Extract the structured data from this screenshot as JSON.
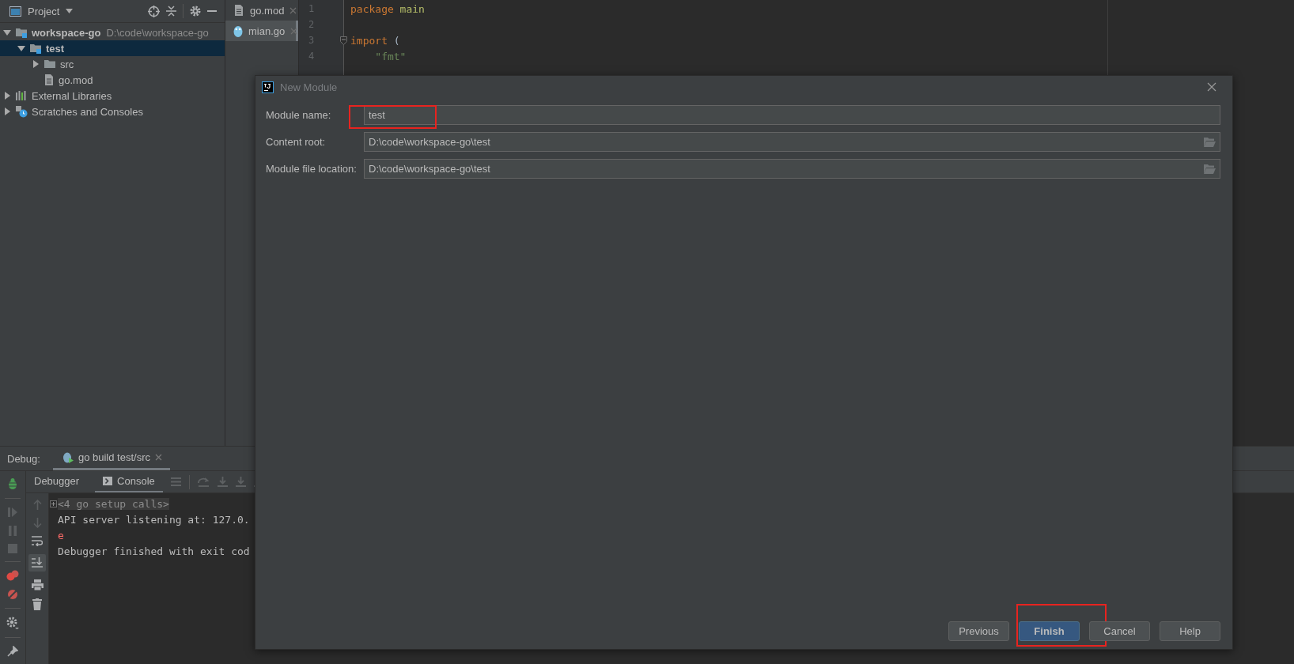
{
  "project_panel": {
    "title": "Project",
    "tree": [
      {
        "label": "workspace-go",
        "path": "D:\\code\\workspace-go",
        "kind": "module",
        "expanded": true,
        "selected": false,
        "children": [
          {
            "label": "test",
            "kind": "module",
            "expanded": true,
            "selected": true,
            "children": [
              {
                "label": "src",
                "kind": "folder",
                "expanded": false,
                "selected": false
              },
              {
                "label": "go.mod",
                "kind": "file",
                "selected": false
              }
            ]
          }
        ]
      },
      {
        "label": "External Libraries",
        "kind": "libraries",
        "expanded": false,
        "selected": false
      },
      {
        "label": "Scratches and Consoles",
        "kind": "scratches",
        "expanded": false,
        "selected": false
      }
    ]
  },
  "editor": {
    "tabs": [
      {
        "label": "go.mod",
        "kind": "mod",
        "selected": false
      },
      {
        "label": "mian.go",
        "kind": "go",
        "selected": true
      }
    ],
    "lines": [
      {
        "number": "1",
        "fold": false,
        "tokens": [
          {
            "text": "package",
            "kind": "keyword"
          },
          {
            "text": " main",
            "kind": "package_name"
          }
        ]
      },
      {
        "number": "2",
        "fold": false
      },
      {
        "number": "3",
        "fold": true,
        "tokens": [
          {
            "text": "import",
            "kind": "keyword"
          },
          {
            "text": " (",
            "kind": "plain"
          }
        ]
      },
      {
        "number": "4",
        "fold": false,
        "tokens": [
          {
            "text": "    \"fmt\"",
            "kind": "string"
          }
        ]
      }
    ]
  },
  "debug": {
    "label": "Debug:",
    "session_tab": {
      "label": "go build test/src",
      "selected": true
    },
    "tabs": [
      {
        "label": "Debugger",
        "kind": "debugger",
        "selected": false
      },
      {
        "label": "Console",
        "kind": "console",
        "selected": true
      }
    ],
    "scroll_to_end": true,
    "console": [
      {
        "text": "<4 go setup calls>",
        "kind": "folded"
      },
      {
        "text": "API server listening at: 127.0.",
        "kind": "output"
      },
      {
        "text": "e",
        "kind": "error"
      },
      {
        "text": "Debugger finished with exit cod",
        "kind": "output"
      }
    ]
  },
  "dialog": {
    "title": "New Module",
    "fields": [
      {
        "label": "Module name:",
        "value": "test",
        "browse": false,
        "highlighted": true
      },
      {
        "label": "Content root:",
        "value": "D:\\code\\workspace-go\\test",
        "browse": true,
        "highlighted": false
      },
      {
        "label": "Module file location:",
        "value": "D:\\code\\workspace-go\\test",
        "browse": true,
        "highlighted": false
      }
    ],
    "buttons": [
      {
        "label": "Previous",
        "kind": "secondary",
        "highlighted": false
      },
      {
        "label": "Finish",
        "kind": "primary",
        "highlighted": true
      },
      {
        "label": "Cancel",
        "kind": "secondary",
        "highlighted": false
      },
      {
        "label": "Help",
        "kind": "secondary",
        "highlighted": false
      }
    ]
  }
}
